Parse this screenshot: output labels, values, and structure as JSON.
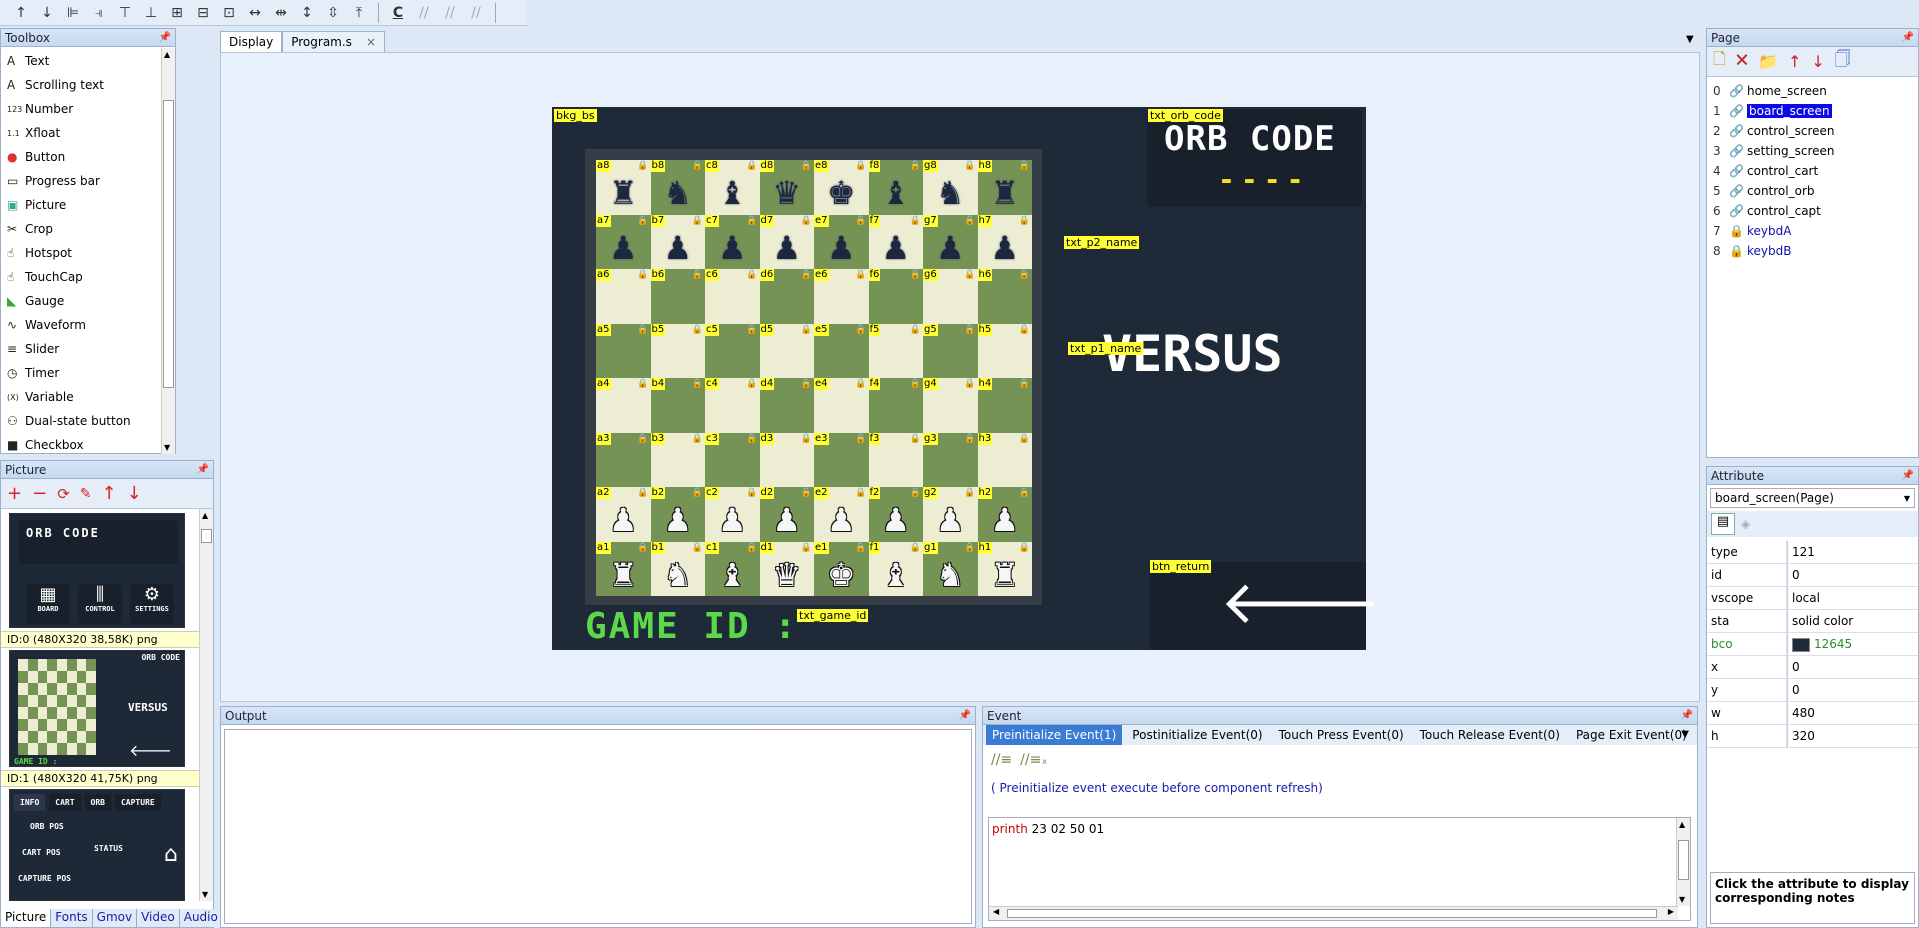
{
  "toolbar": {
    "icons": [
      "arrow-up-icon",
      "arrow-down-icon",
      "align-left-icon",
      "align-right-icon",
      "align-top-icon",
      "align-bottom-icon",
      "center-horizontal-icon",
      "center-vertical-icon",
      "grid-icon",
      "same-width-icon",
      "distribute-horizontal-icon",
      "same-height-icon",
      "distribute-vertical-icon",
      "space-vertical-icon",
      "clear-icon",
      "comment-icon",
      "uncomment-icon",
      "remove-comment-icon"
    ]
  },
  "toolbox": {
    "title": "Toolbox",
    "items": [
      {
        "icon": "A",
        "label": "Text"
      },
      {
        "icon": "A",
        "label": "Scrolling text"
      },
      {
        "icon": "123",
        "label": "Number"
      },
      {
        "icon": "1.1",
        "label": "Xfloat"
      },
      {
        "icon": "●",
        "label": "Button"
      },
      {
        "icon": "▭",
        "label": "Progress bar"
      },
      {
        "icon": "▣",
        "label": "Picture"
      },
      {
        "icon": "✂",
        "label": "Crop"
      },
      {
        "icon": "☝",
        "label": "Hotspot"
      },
      {
        "icon": "☝",
        "label": "TouchCap"
      },
      {
        "icon": "◣",
        "label": "Gauge"
      },
      {
        "icon": "∿",
        "label": "Waveform"
      },
      {
        "icon": "≡",
        "label": "Slider"
      },
      {
        "icon": "◷",
        "label": "Timer"
      },
      {
        "icon": "(X)",
        "label": "Variable"
      },
      {
        "icon": "⚇",
        "label": "Dual-state button"
      },
      {
        "icon": "■",
        "label": "Checkbox"
      }
    ]
  },
  "picture_panel": {
    "title": "Picture",
    "thumb0": {
      "title": "ORB CODE",
      "buttons": [
        "BOARD",
        "CONTROL",
        "SETTINGS"
      ]
    },
    "info0": "ID:0  (480X320 38,58K) png",
    "thumb1": {
      "orb": "ORB CODE",
      "versus": "VERSUS",
      "game": "GAME ID :"
    },
    "info1": "ID:1  (480X320 41,75K) png",
    "thumb2": {
      "tabs": [
        "INFO",
        "CART",
        "ORB",
        "CAPTURE"
      ],
      "labels": [
        "ORB POS",
        "CART POS",
        "STATUS",
        "CAPTURE POS"
      ]
    },
    "bottom_tabs": [
      "Picture",
      "Fonts",
      "Gmov",
      "Video",
      "Audio"
    ]
  },
  "editor_tabs": [
    {
      "label": "Display",
      "active": true
    },
    {
      "label": "Program.s",
      "active": false
    }
  ],
  "editor_tab_close": "×",
  "canvas": {
    "bkg_label": "bkg_bs",
    "orb_code_label": "txt_orb_code",
    "orb_code_title": "ORB CODE",
    "orb_code_value": "----",
    "p2_label": "txt_p2_name",
    "p1_label": "txt_p1_name",
    "versus": "VERSUS",
    "game_id_text": "GAME ID :",
    "game_id_label": "txt_game_id",
    "btn_return_label": "btn_return",
    "arrow": "🡐",
    "files": [
      "a",
      "b",
      "c",
      "d",
      "e",
      "f",
      "g",
      "h"
    ],
    "ranks": [
      "8",
      "7",
      "6",
      "5",
      "4",
      "3",
      "2",
      "1"
    ],
    "pieces": {
      "8": [
        "♜",
        "♞",
        "♝",
        "♛",
        "♚",
        "♝",
        "♞",
        "♜"
      ],
      "7": [
        "♟",
        "♟",
        "♟",
        "♟",
        "♟",
        "♟",
        "♟",
        "♟"
      ],
      "2": [
        "♟",
        "♟",
        "♟",
        "♟",
        "♟",
        "♟",
        "♟",
        "♟"
      ],
      "1": [
        "♜",
        "♞",
        "♝",
        "♛",
        "♚",
        "♝",
        "♞",
        "♜"
      ]
    }
  },
  "output": {
    "title": "Output"
  },
  "event": {
    "title": "Event",
    "tabs": [
      "Preinitialize Event(1)",
      "Postinitialize Event(0)",
      "Touch Press Event(0)",
      "Touch Release Event(0)",
      "Page Exit Event(0)"
    ],
    "description": "( Preinitialize event execute before component refresh)",
    "code_keyword": "printh",
    "code_args": " 23 02 50 01"
  },
  "page_panel": {
    "title": "Page",
    "pages": [
      {
        "num": "0",
        "name": "home_screen",
        "selected": false,
        "locked": false
      },
      {
        "num": "1",
        "name": "board_screen",
        "selected": true,
        "locked": false
      },
      {
        "num": "2",
        "name": "control_screen",
        "selected": false,
        "locked": false
      },
      {
        "num": "3",
        "name": "setting_screen",
        "selected": false,
        "locked": false
      },
      {
        "num": "4",
        "name": "control_cart",
        "selected": false,
        "locked": false
      },
      {
        "num": "5",
        "name": "control_orb",
        "selected": false,
        "locked": false
      },
      {
        "num": "6",
        "name": "control_capt",
        "selected": false,
        "locked": false
      },
      {
        "num": "7",
        "name": "keybdA",
        "selected": false,
        "locked": true
      },
      {
        "num": "8",
        "name": "keybdB",
        "selected": false,
        "locked": true
      }
    ]
  },
  "attribute_panel": {
    "title": "Attribute",
    "selector": "board_screen(Page)",
    "rows": [
      {
        "k": "type",
        "v": "121"
      },
      {
        "k": "id",
        "v": "0"
      },
      {
        "k": "vscope",
        "v": "local"
      },
      {
        "k": "sta",
        "v": "solid color"
      },
      {
        "k": "bco",
        "v": "12645"
      },
      {
        "k": "x",
        "v": "0"
      },
      {
        "k": "y",
        "v": "0"
      },
      {
        "k": "w",
        "v": "480"
      },
      {
        "k": "h",
        "v": "320"
      }
    ],
    "note": "Click the attribute to display corresponding notes"
  },
  "colors": {
    "canvas_bg": "#1f2a38",
    "light_square": "#ecedd3",
    "dark_square": "#749355",
    "label_yellow": "#ffff33",
    "selection": "#0a0ae6",
    "bco_swatch": "#1f2a38",
    "game_id_green": "#5bd94a"
  }
}
